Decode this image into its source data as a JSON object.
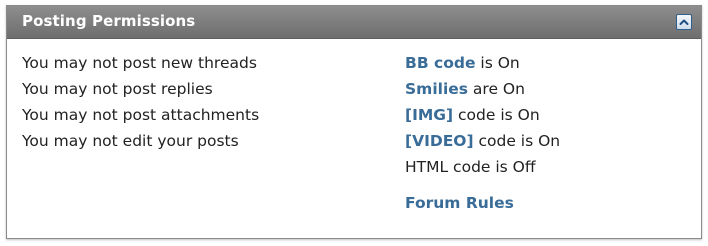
{
  "panel": {
    "title": "Posting Permissions",
    "collapse_icon": "collapse-up-icon"
  },
  "permissions": [
    "You may not post new threads",
    "You may not post replies",
    "You may not post attachments",
    "You may not edit your posts"
  ],
  "codes": {
    "bbcode": {
      "link": "BB code",
      "text": " is On"
    },
    "smilies": {
      "link": "Smilies",
      "text": " are On"
    },
    "img": {
      "link": "[IMG]",
      "text": " code is On"
    },
    "video": {
      "link": "[VIDEO]",
      "text": " code is On"
    },
    "html": "HTML code is Off"
  },
  "forum_rules": "Forum Rules",
  "colors": {
    "header": "#7b7b7b",
    "link": "#3a6c98",
    "text": "#222222"
  }
}
